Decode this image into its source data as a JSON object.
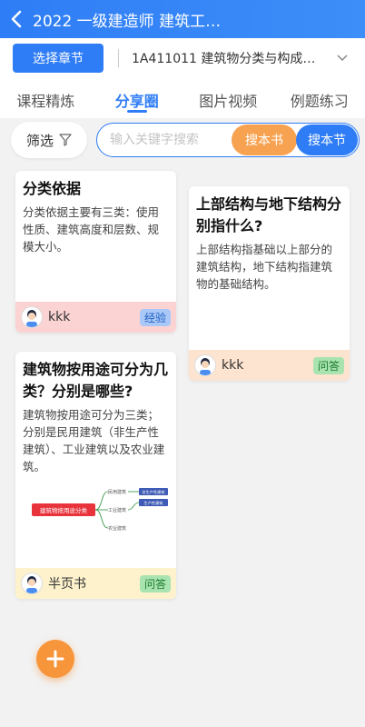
{
  "header": {
    "title": "2022 一级建造师 建筑工…"
  },
  "chapter": {
    "button_label": "选择章节",
    "current": "1A411011 建筑物分类与构成…"
  },
  "tabs": [
    {
      "label": "课程精炼"
    },
    {
      "label": "分享圈"
    },
    {
      "label": "图片视频"
    },
    {
      "label": "例题练习"
    }
  ],
  "filter": {
    "label": "筛选"
  },
  "search": {
    "placeholder": "输入关键字搜索",
    "btn_orange": "搜本书",
    "btn_blue": "搜本节"
  },
  "cards": [
    {
      "title": "分类依据",
      "body": "分类依据主要有三类：使用性质、建筑高度和层数、规模大小。",
      "user": "kkk",
      "tag": "经验"
    },
    {
      "title": "上部结构与地下结构分别指什么?",
      "body": "上部结构指基础以上部分的建筑结构，地下结构指建筑物的基础结构。",
      "user": "kkk",
      "tag": "问答"
    },
    {
      "title": "建筑物按用途可分为几类？分别是哪些?",
      "body": "建筑物按用途可分为三类；分别是民用建筑（非生产性建筑）、工业建筑以及农业建筑。",
      "user": "半页书",
      "tag": "问答",
      "diagram": {
        "root": "建筑物按用途分类",
        "branches": [
          "民用建筑",
          "工业建筑",
          "农业建筑"
        ],
        "sub": [
          "非生产性建筑",
          "生产性建筑"
        ]
      }
    }
  ],
  "colors": {
    "accent": "#2f7df6",
    "orange": "#f7a250",
    "card1_foot": "#fbd3d3",
    "card2_foot": "#fde4d0",
    "card3_foot": "#fdf2cc"
  }
}
